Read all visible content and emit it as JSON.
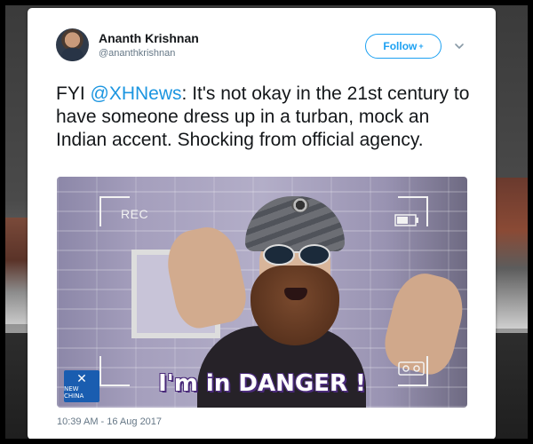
{
  "tweet": {
    "user_name": "Ananth Krishnan",
    "user_handle": "@ananthkrishnan",
    "follow_label": "Follow",
    "text_prefix": "FYI ",
    "mention": "@XHNews",
    "text_body": ": It's not okay in the 21st century to have someone dress up in a turban, mock an Indian accent. Shocking from official agency.",
    "timestamp": "10:39 AM - 16 Aug 2017"
  },
  "media": {
    "rec_label": "REC",
    "caption": "I'm in DANGER !",
    "logo_text": "NEW CHINA",
    "icons": [
      "battery-icon",
      "tape-icon",
      "chevron-down-icon",
      "plus-icon"
    ]
  },
  "colors": {
    "link": "#1b95e0",
    "follow": "#1da1f2",
    "text": "#14171a",
    "muted": "#657786"
  }
}
